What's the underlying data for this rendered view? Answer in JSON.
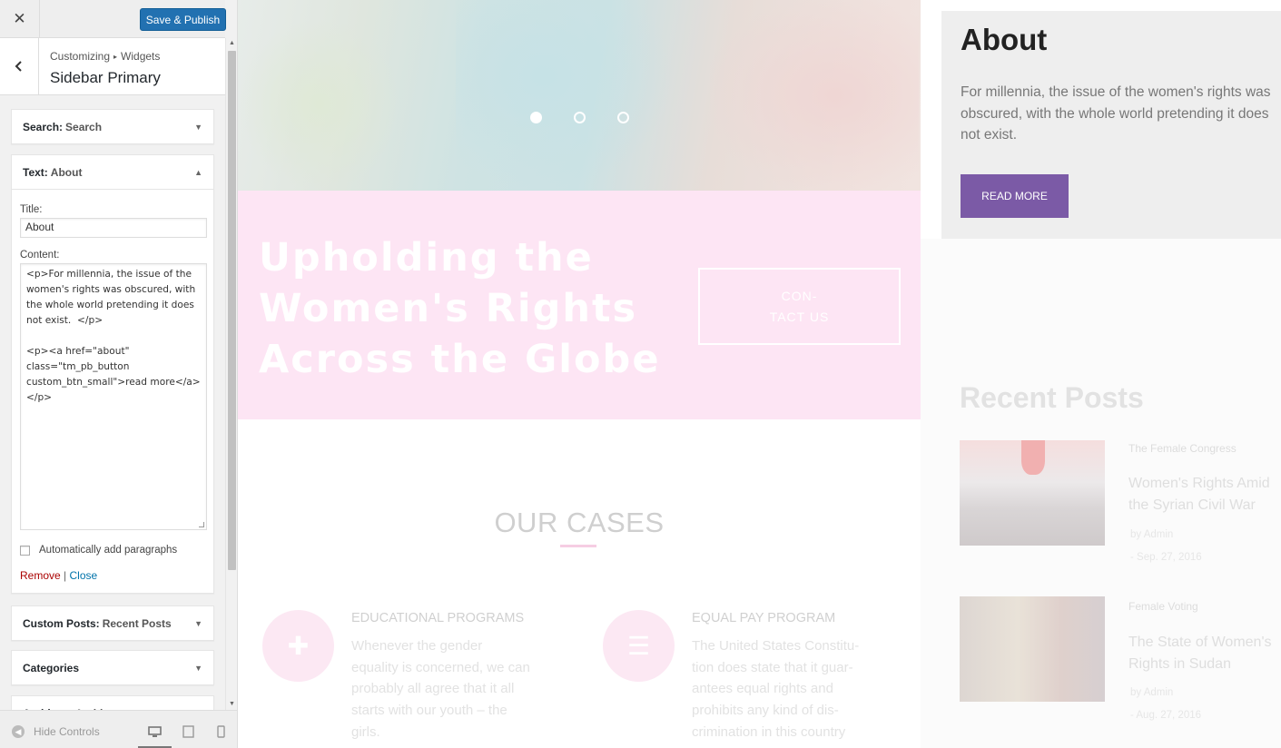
{
  "customizer": {
    "close_glyph": "✕",
    "publish_label": "Save & Publish",
    "breadcrumb": [
      "Customizing",
      "Widgets"
    ],
    "breadcrumb_sep": "▸",
    "section_title": "Sidebar Primary",
    "widgets": {
      "search": {
        "type": "Search:",
        "name": "Search"
      },
      "text": {
        "type": "Text:",
        "name": "About",
        "title_label": "Title:",
        "title_value": "About",
        "content_label": "Content:",
        "content_value": "<p>For millennia, the issue of the women's rights was obscured, with the whole world pretending it does not exist.  </p>\n\n<p><a href=\"about\" class=\"tm_pb_button custom_btn_small\">read more</a></p>",
        "auto_paragraphs_label": "Automatically add paragraphs",
        "auto_paragraphs_checked": false,
        "remove_label": "Remove",
        "separator": "|",
        "close_label": "Close"
      },
      "custom_posts": {
        "type": "Custom Posts:",
        "name": "Recent Posts"
      },
      "categories": {
        "type": "Categories",
        "name": ""
      },
      "archives": {
        "type": "Archives:",
        "name": "Archives"
      }
    },
    "footer": {
      "hide_controls_label": "Hide Controls",
      "devices": [
        "desktop-icon",
        "tablet-icon",
        "mobile-icon"
      ],
      "active_device": "desktop"
    }
  },
  "preview": {
    "slider_dots": {
      "count": 3,
      "active": 0
    },
    "banner_title": "Upholding the Women's Rights Across the Globe",
    "contact_button": "CON-TACT US",
    "cases_title": "OUR CASES",
    "cases": [
      {
        "icon": "puzzle-icon",
        "title": "EDUCATIONAL PROGRAMS",
        "text": "Whenever the gender equality is concerned, we can probably all agree that it all starts with our youth – the girls."
      },
      {
        "icon": "list-icon",
        "title": "EQUAL PAY PROGRAM",
        "text": "The United States Constitu-tion does state that it guar-antees equal rights and prohibits any kind of dis-crimination in this country"
      }
    ],
    "sidebar_about": {
      "title": "About",
      "text": "For millennia, the issue of the women's rights was obscured, with the whole world pretending it does not exist.",
      "button": "READ MORE"
    },
    "recent_posts": {
      "title": "Recent Posts",
      "posts": [
        {
          "category": "The Female Congress",
          "title": "Women's Rights Amid the Syrian Civil War",
          "author": "by Admin",
          "date": "- Sep. 27, 2016"
        },
        {
          "category": "Female Voting",
          "title": "The State of Women's Rights in Sudan",
          "author": "by Admin",
          "date": "- Aug. 27, 2016"
        }
      ]
    },
    "colors": {
      "banner_pink": "#fde5f4",
      "read_more_purple": "#7b5aa6",
      "publish_blue": "#2271b1"
    }
  }
}
